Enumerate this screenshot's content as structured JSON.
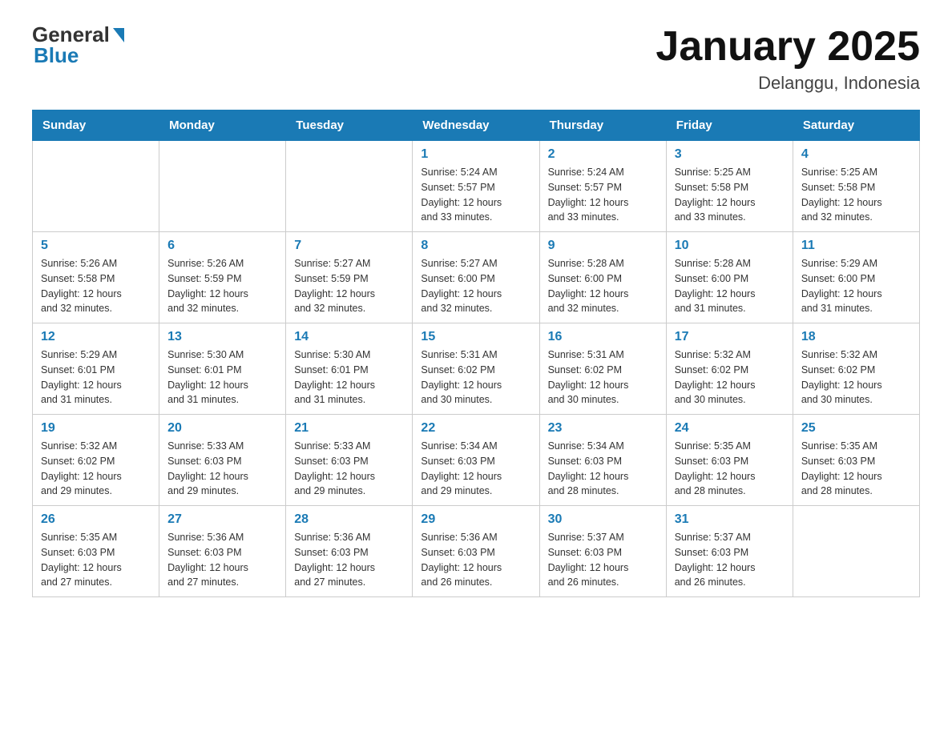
{
  "header": {
    "logo_general": "General",
    "logo_blue": "Blue",
    "month_year": "January 2025",
    "location": "Delanggu, Indonesia"
  },
  "weekdays": [
    "Sunday",
    "Monday",
    "Tuesday",
    "Wednesday",
    "Thursday",
    "Friday",
    "Saturday"
  ],
  "weeks": [
    [
      {
        "day": "",
        "info": ""
      },
      {
        "day": "",
        "info": ""
      },
      {
        "day": "",
        "info": ""
      },
      {
        "day": "1",
        "info": "Sunrise: 5:24 AM\nSunset: 5:57 PM\nDaylight: 12 hours\nand 33 minutes."
      },
      {
        "day": "2",
        "info": "Sunrise: 5:24 AM\nSunset: 5:57 PM\nDaylight: 12 hours\nand 33 minutes."
      },
      {
        "day": "3",
        "info": "Sunrise: 5:25 AM\nSunset: 5:58 PM\nDaylight: 12 hours\nand 33 minutes."
      },
      {
        "day": "4",
        "info": "Sunrise: 5:25 AM\nSunset: 5:58 PM\nDaylight: 12 hours\nand 32 minutes."
      }
    ],
    [
      {
        "day": "5",
        "info": "Sunrise: 5:26 AM\nSunset: 5:58 PM\nDaylight: 12 hours\nand 32 minutes."
      },
      {
        "day": "6",
        "info": "Sunrise: 5:26 AM\nSunset: 5:59 PM\nDaylight: 12 hours\nand 32 minutes."
      },
      {
        "day": "7",
        "info": "Sunrise: 5:27 AM\nSunset: 5:59 PM\nDaylight: 12 hours\nand 32 minutes."
      },
      {
        "day": "8",
        "info": "Sunrise: 5:27 AM\nSunset: 6:00 PM\nDaylight: 12 hours\nand 32 minutes."
      },
      {
        "day": "9",
        "info": "Sunrise: 5:28 AM\nSunset: 6:00 PM\nDaylight: 12 hours\nand 32 minutes."
      },
      {
        "day": "10",
        "info": "Sunrise: 5:28 AM\nSunset: 6:00 PM\nDaylight: 12 hours\nand 31 minutes."
      },
      {
        "day": "11",
        "info": "Sunrise: 5:29 AM\nSunset: 6:00 PM\nDaylight: 12 hours\nand 31 minutes."
      }
    ],
    [
      {
        "day": "12",
        "info": "Sunrise: 5:29 AM\nSunset: 6:01 PM\nDaylight: 12 hours\nand 31 minutes."
      },
      {
        "day": "13",
        "info": "Sunrise: 5:30 AM\nSunset: 6:01 PM\nDaylight: 12 hours\nand 31 minutes."
      },
      {
        "day": "14",
        "info": "Sunrise: 5:30 AM\nSunset: 6:01 PM\nDaylight: 12 hours\nand 31 minutes."
      },
      {
        "day": "15",
        "info": "Sunrise: 5:31 AM\nSunset: 6:02 PM\nDaylight: 12 hours\nand 30 minutes."
      },
      {
        "day": "16",
        "info": "Sunrise: 5:31 AM\nSunset: 6:02 PM\nDaylight: 12 hours\nand 30 minutes."
      },
      {
        "day": "17",
        "info": "Sunrise: 5:32 AM\nSunset: 6:02 PM\nDaylight: 12 hours\nand 30 minutes."
      },
      {
        "day": "18",
        "info": "Sunrise: 5:32 AM\nSunset: 6:02 PM\nDaylight: 12 hours\nand 30 minutes."
      }
    ],
    [
      {
        "day": "19",
        "info": "Sunrise: 5:32 AM\nSunset: 6:02 PM\nDaylight: 12 hours\nand 29 minutes."
      },
      {
        "day": "20",
        "info": "Sunrise: 5:33 AM\nSunset: 6:03 PM\nDaylight: 12 hours\nand 29 minutes."
      },
      {
        "day": "21",
        "info": "Sunrise: 5:33 AM\nSunset: 6:03 PM\nDaylight: 12 hours\nand 29 minutes."
      },
      {
        "day": "22",
        "info": "Sunrise: 5:34 AM\nSunset: 6:03 PM\nDaylight: 12 hours\nand 29 minutes."
      },
      {
        "day": "23",
        "info": "Sunrise: 5:34 AM\nSunset: 6:03 PM\nDaylight: 12 hours\nand 28 minutes."
      },
      {
        "day": "24",
        "info": "Sunrise: 5:35 AM\nSunset: 6:03 PM\nDaylight: 12 hours\nand 28 minutes."
      },
      {
        "day": "25",
        "info": "Sunrise: 5:35 AM\nSunset: 6:03 PM\nDaylight: 12 hours\nand 28 minutes."
      }
    ],
    [
      {
        "day": "26",
        "info": "Sunrise: 5:35 AM\nSunset: 6:03 PM\nDaylight: 12 hours\nand 27 minutes."
      },
      {
        "day": "27",
        "info": "Sunrise: 5:36 AM\nSunset: 6:03 PM\nDaylight: 12 hours\nand 27 minutes."
      },
      {
        "day": "28",
        "info": "Sunrise: 5:36 AM\nSunset: 6:03 PM\nDaylight: 12 hours\nand 27 minutes."
      },
      {
        "day": "29",
        "info": "Sunrise: 5:36 AM\nSunset: 6:03 PM\nDaylight: 12 hours\nand 26 minutes."
      },
      {
        "day": "30",
        "info": "Sunrise: 5:37 AM\nSunset: 6:03 PM\nDaylight: 12 hours\nand 26 minutes."
      },
      {
        "day": "31",
        "info": "Sunrise: 5:37 AM\nSunset: 6:03 PM\nDaylight: 12 hours\nand 26 minutes."
      },
      {
        "day": "",
        "info": ""
      }
    ]
  ]
}
